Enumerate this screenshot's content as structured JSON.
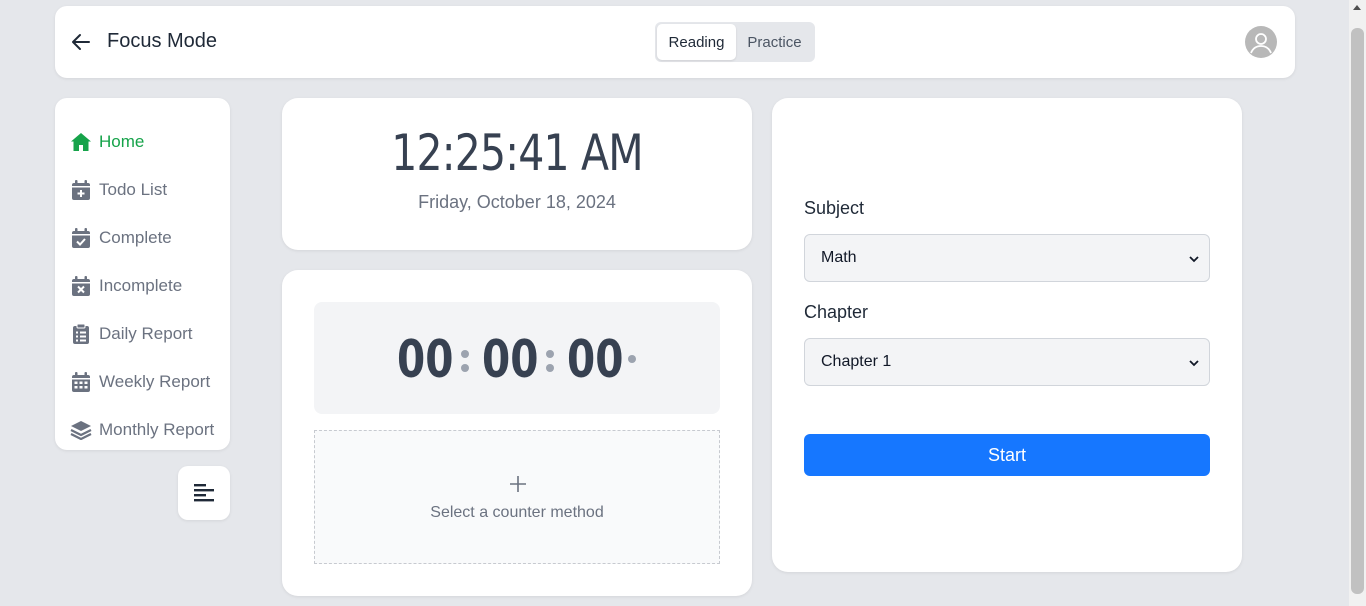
{
  "header": {
    "title": "Focus Mode",
    "modes": [
      {
        "label": "Reading",
        "active": true
      },
      {
        "label": "Practice",
        "active": false
      }
    ]
  },
  "sidebar": {
    "items": [
      {
        "label": "Home",
        "icon": "home-icon",
        "active": true
      },
      {
        "label": "Todo List",
        "icon": "calendar-plus-icon"
      },
      {
        "label": "Complete",
        "icon": "calendar-check-icon"
      },
      {
        "label": "Incomplete",
        "icon": "calendar-x-icon"
      },
      {
        "label": "Daily Report",
        "icon": "clipboard-list-icon"
      },
      {
        "label": "Weekly Report",
        "icon": "calendar-grid-icon"
      },
      {
        "label": "Monthly Report",
        "icon": "layers-icon"
      }
    ]
  },
  "clock": {
    "time": "12:25:41 AM",
    "date": "Friday, October 18, 2024"
  },
  "counter": {
    "hours": "00",
    "minutes": "00",
    "seconds": "00",
    "method_prompt": "Select a counter method"
  },
  "form": {
    "subject_label": "Subject",
    "subject_value": "Math",
    "chapter_label": "Chapter",
    "chapter_value": "Chapter 1",
    "start_label": "Start"
  },
  "colors": {
    "accent": "#1677ff",
    "active_nav": "#16a34a",
    "background": "#e5e7eb"
  }
}
